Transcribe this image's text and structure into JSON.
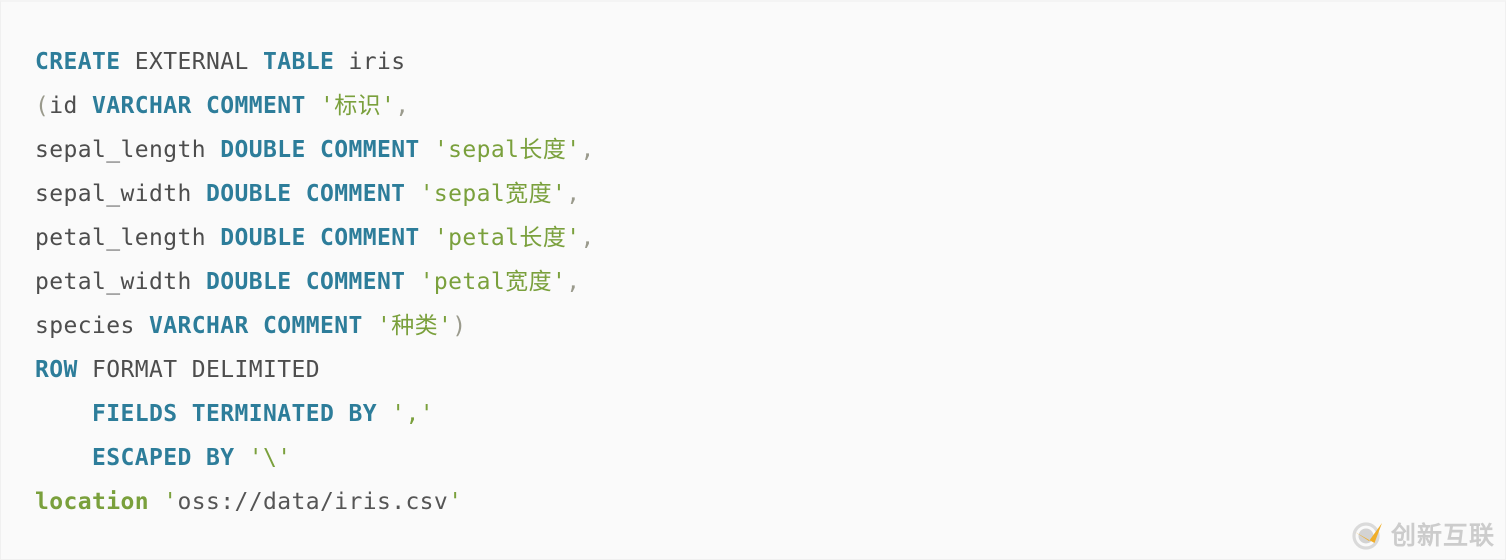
{
  "colors": {
    "background": "#fafafa",
    "border": "#f0f0f0",
    "keyword": "#2d7d9a",
    "plain": "#4d4d4d",
    "string": "#7aa03c",
    "punctuation": "#9a9a8c",
    "watermark_text": "#c9c9c9",
    "watermark_accent": "#f0a818"
  },
  "code": {
    "language": "sql",
    "lines": [
      {
        "indent": 0,
        "tokens": [
          {
            "t": "CREATE",
            "c": "kw"
          },
          {
            "t": " ",
            "c": "plain"
          },
          {
            "t": "EXTERNAL",
            "c": "plain"
          },
          {
            "t": " ",
            "c": "plain"
          },
          {
            "t": "TABLE",
            "c": "kw"
          },
          {
            "t": " iris",
            "c": "plain"
          }
        ]
      },
      {
        "indent": 0,
        "tokens": [
          {
            "t": "(",
            "c": "punct"
          },
          {
            "t": "id ",
            "c": "plain"
          },
          {
            "t": "VARCHAR",
            "c": "kw"
          },
          {
            "t": " ",
            "c": "plain"
          },
          {
            "t": "COMMENT",
            "c": "kw"
          },
          {
            "t": " ",
            "c": "plain"
          },
          {
            "t": "'标识'",
            "c": "str"
          },
          {
            "t": ",",
            "c": "punct"
          }
        ]
      },
      {
        "indent": 0,
        "tokens": [
          {
            "t": "sepal_length ",
            "c": "plain"
          },
          {
            "t": "DOUBLE",
            "c": "kw"
          },
          {
            "t": " ",
            "c": "plain"
          },
          {
            "t": "COMMENT",
            "c": "kw"
          },
          {
            "t": " ",
            "c": "plain"
          },
          {
            "t": "'sepal长度'",
            "c": "str"
          },
          {
            "t": ",",
            "c": "punct"
          }
        ]
      },
      {
        "indent": 0,
        "tokens": [
          {
            "t": "sepal_width ",
            "c": "plain"
          },
          {
            "t": "DOUBLE",
            "c": "kw"
          },
          {
            "t": " ",
            "c": "plain"
          },
          {
            "t": "COMMENT",
            "c": "kw"
          },
          {
            "t": " ",
            "c": "plain"
          },
          {
            "t": "'sepal宽度'",
            "c": "str"
          },
          {
            "t": ",",
            "c": "punct"
          }
        ]
      },
      {
        "indent": 0,
        "tokens": [
          {
            "t": "petal_length ",
            "c": "plain"
          },
          {
            "t": "DOUBLE",
            "c": "kw"
          },
          {
            "t": " ",
            "c": "plain"
          },
          {
            "t": "COMMENT",
            "c": "kw"
          },
          {
            "t": " ",
            "c": "plain"
          },
          {
            "t": "'petal长度'",
            "c": "str"
          },
          {
            "t": ",",
            "c": "punct"
          }
        ]
      },
      {
        "indent": 0,
        "tokens": [
          {
            "t": "petal_width ",
            "c": "plain"
          },
          {
            "t": "DOUBLE",
            "c": "kw"
          },
          {
            "t": " ",
            "c": "plain"
          },
          {
            "t": "COMMENT",
            "c": "kw"
          },
          {
            "t": " ",
            "c": "plain"
          },
          {
            "t": "'petal宽度'",
            "c": "str"
          },
          {
            "t": ",",
            "c": "punct"
          }
        ]
      },
      {
        "indent": 0,
        "tokens": [
          {
            "t": "species ",
            "c": "plain"
          },
          {
            "t": "VARCHAR",
            "c": "kw"
          },
          {
            "t": " ",
            "c": "plain"
          },
          {
            "t": "COMMENT",
            "c": "kw"
          },
          {
            "t": " ",
            "c": "plain"
          },
          {
            "t": "'种类'",
            "c": "str"
          },
          {
            "t": ")",
            "c": "punct"
          }
        ]
      },
      {
        "indent": 0,
        "tokens": [
          {
            "t": "ROW",
            "c": "kw"
          },
          {
            "t": " FORMAT DELIMITED",
            "c": "plain"
          }
        ]
      },
      {
        "indent": 4,
        "tokens": [
          {
            "t": "FIELDS TERMINATED BY",
            "c": "kw"
          },
          {
            "t": " ",
            "c": "plain"
          },
          {
            "t": "','",
            "c": "str"
          }
        ]
      },
      {
        "indent": 4,
        "tokens": [
          {
            "t": "ESCAPED BY",
            "c": "kw"
          },
          {
            "t": " ",
            "c": "plain"
          },
          {
            "t": "'\\'",
            "c": "str"
          }
        ]
      },
      {
        "indent": 0,
        "tokens": [
          {
            "t": "location",
            "c": "fn"
          },
          {
            "t": " ",
            "c": "plain"
          },
          {
            "t": "'",
            "c": "str"
          },
          {
            "t": "oss://data/iris.csv",
            "c": "strplain"
          },
          {
            "t": "'",
            "c": "str"
          }
        ]
      }
    ]
  },
  "watermark": {
    "text": "创新互联",
    "logo_icon": "swoosh-circle-logo"
  }
}
